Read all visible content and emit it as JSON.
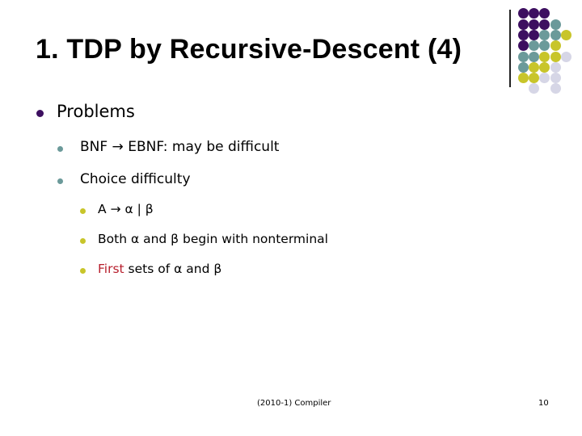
{
  "slide": {
    "title": "1. TDP by Recursive-Descent (4)",
    "bullets": [
      {
        "level": 1,
        "text": "Problems",
        "children": [
          {
            "level": 2,
            "text": "BNF → EBNF: may be difficult"
          },
          {
            "level": 2,
            "text": "Choice difficulty",
            "children": [
              {
                "level": 3,
                "text": "A → α | β"
              },
              {
                "level": 3,
                "text": "Both α and β begin with nonterminal"
              },
              {
                "level": 3,
                "highlight": "First",
                "text": " sets of α and β"
              }
            ]
          }
        ]
      }
    ]
  },
  "footer": {
    "course": "(2010-1) Compiler",
    "page_number": "10"
  },
  "colors": {
    "purple": "#3d0f60",
    "teal": "#6b9a9a",
    "olive": "#c8c52a",
    "lavender": "#d6d6e6",
    "highlight_red": "#b8202e"
  },
  "decoration": {
    "dot_grid_rows": [
      [
        "purple",
        "purple",
        "purple",
        null,
        null
      ],
      [
        "purple",
        "purple",
        "purple",
        "teal",
        null
      ],
      [
        "purple",
        "purple",
        "teal",
        "teal",
        "olive"
      ],
      [
        "purple",
        "teal",
        "teal",
        "olive",
        null
      ],
      [
        "teal",
        "teal",
        "olive",
        "olive",
        "lavender"
      ],
      [
        "teal",
        "olive",
        "olive",
        "lavender",
        null
      ],
      [
        "olive",
        "olive",
        "lavender",
        "lavender",
        null
      ],
      [
        null,
        "lavender",
        null,
        "lavender",
        null
      ]
    ]
  }
}
